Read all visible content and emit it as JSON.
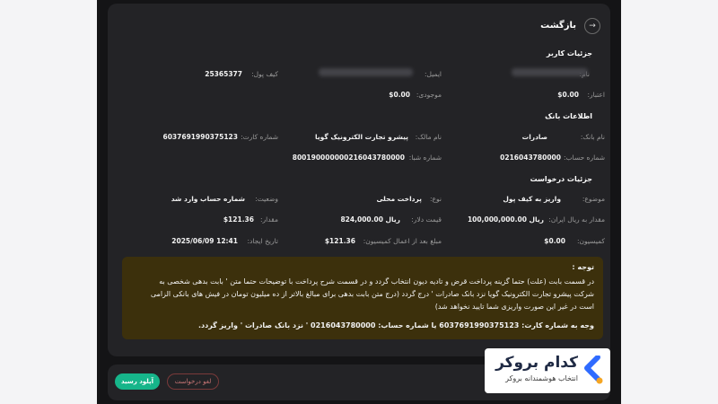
{
  "header": {
    "back_label": "بازگشت"
  },
  "sections": {
    "wallet_title": "جزئیات کاربر",
    "bank_title": "اطلاعات بانک",
    "request_title": "جزئیات درخواست"
  },
  "wallet": {
    "name_label": "نام:",
    "email_label": "ایمیل:",
    "wallet_label": "کیف پول:",
    "wallet_value": "25365377",
    "credit_label": "اعتبار:",
    "credit_value": "$0.00",
    "balance_label": "موجودی:",
    "balance_value": "$0.00"
  },
  "bank": {
    "bank_name_label": "نام بانک:",
    "bank_name_value": "صادرات",
    "owner_label": "نام مالک:",
    "owner_value": "پیشرو تجارت الکترونیک گویا",
    "card_label": "شماره کارت:",
    "card_value": "6037691990375123",
    "account_label": "شماره حساب:",
    "account_value": "0216043780000",
    "sheba_label": "شماره شبا:",
    "sheba_value": "800190000000216043780000"
  },
  "request": {
    "subject_label": "موضوع:",
    "subject_value": "واریز به کیف پول",
    "type_label": "نوع:",
    "type_value": "پرداخت محلی",
    "status_label": "وضعیت:",
    "status_value": "شماره حساب وارد شد",
    "rial_amount_label": "مقدار به ریال ایران:",
    "rial_amount_value": "ریال 100,000,000.00",
    "dollar_price_label": "قیمت دلار:",
    "dollar_price_value": "ریال 824,000.00",
    "amount_label": "مقدار:",
    "amount_value": "$121.36",
    "commission_label": "کمیسیون:",
    "commission_value": "$0.00",
    "net_label": "مبلغ بعد از اعمال کمیسیون:",
    "net_value": "$121.36",
    "created_label": "تاریخ ایجاد:",
    "created_value": "12:41 2025/06/09"
  },
  "notice": {
    "title": "توجه :",
    "line1": "در قسمت بابت (علت) حتما گزینه پرداخت قرض و تادیه دیون انتخاب گردد و در قسمت شرح پرداخت با توضیحات حتما متن ' بابت بدهی شخصی به",
    "line2": "شرکت پیشرو تجارت الکترونیک گویا نزد بانک صادرات ' درج گردد (درج متن بابت بدهی برای مبالغ بالاتر از ده میلیون تومان در فیش های بانکی الزامی",
    "line3": "است در غیر این صورت واریزی شما تایید نخواهد شد)",
    "line4": "وجه به شماره کارت: 6037691990375123 یا شماره حساب: 0216043780000 ' نزد بانک صادرات ' واریز گردد."
  },
  "footer": {
    "upload_label": "آپلود رسید",
    "cancel_label": "لغو درخواست"
  },
  "brand": {
    "name": "کدام بروکر",
    "tagline": "انتخاب هوشمندانه بروکر",
    "accent_color": "#2f6bff",
    "accent_color_2": "#f5a623"
  }
}
